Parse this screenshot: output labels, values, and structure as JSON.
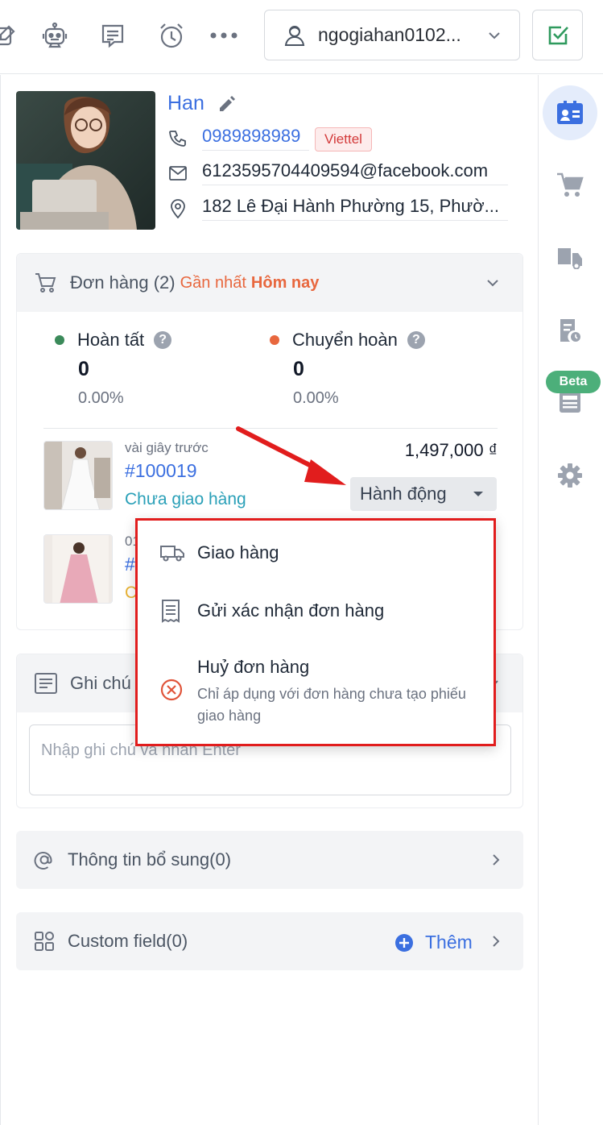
{
  "toolbar": {
    "icons": [
      "edit-check-icon",
      "bot-icon",
      "message-icon",
      "alarm-icon",
      "more-icon"
    ],
    "user_name": "ngogiahan0102...",
    "check_icon": "checkbox-check-icon"
  },
  "profile": {
    "name": "Han",
    "phone": "0989898989",
    "carrier": "Viettel",
    "email": "6123595704409594@facebook.com",
    "address": "182 Lê Đại Hành Phường 15, Phườ..."
  },
  "orders": {
    "title": "Đơn hàng (2)",
    "recent_label": "Gần nhất",
    "recent_value": "Hôm nay",
    "stats": [
      {
        "label": "Hoàn tất",
        "count": "0",
        "percent": "0.00%",
        "color": "#3b8a5a"
      },
      {
        "label": "Chuyển hoàn",
        "count": "0",
        "percent": "0.00%",
        "color": "#e8673e"
      }
    ],
    "items": [
      {
        "time": "vài giây trước",
        "code": "#100019",
        "status": "Chưa giao hàng",
        "amount": "1,497,000 ₫"
      },
      {
        "time": "01",
        "code": "#",
        "status": "C"
      }
    ],
    "action_label": "Hành động",
    "menu": [
      {
        "icon": "truck-icon",
        "label": "Giao hàng"
      },
      {
        "icon": "receipt-icon",
        "label": "Gửi xác nhận đơn hàng"
      },
      {
        "icon": "cancel-icon",
        "label": "Huỷ đơn hàng",
        "sub": "Chỉ áp dụng với đơn hàng chưa tạo phiếu giao hàng"
      }
    ]
  },
  "notes": {
    "title": "Ghi chú",
    "placeholder": "Nhập ghi chú và nhấn Enter"
  },
  "extra_info": {
    "title": "Thông tin bổ sung(0)"
  },
  "custom_field": {
    "title": "Custom field(0)",
    "add_label": "Thêm"
  },
  "rail": {
    "items": [
      "contact-card-icon",
      "cart-icon",
      "shipping-icon",
      "report-icon",
      "news-icon",
      "settings-icon"
    ],
    "beta_label": "Beta"
  },
  "colors": {
    "accent": "#3b6fe0",
    "status_pending": "#2aa0b8",
    "highlight_border": "#e11d1d",
    "recent_orange": "#e8673e"
  }
}
